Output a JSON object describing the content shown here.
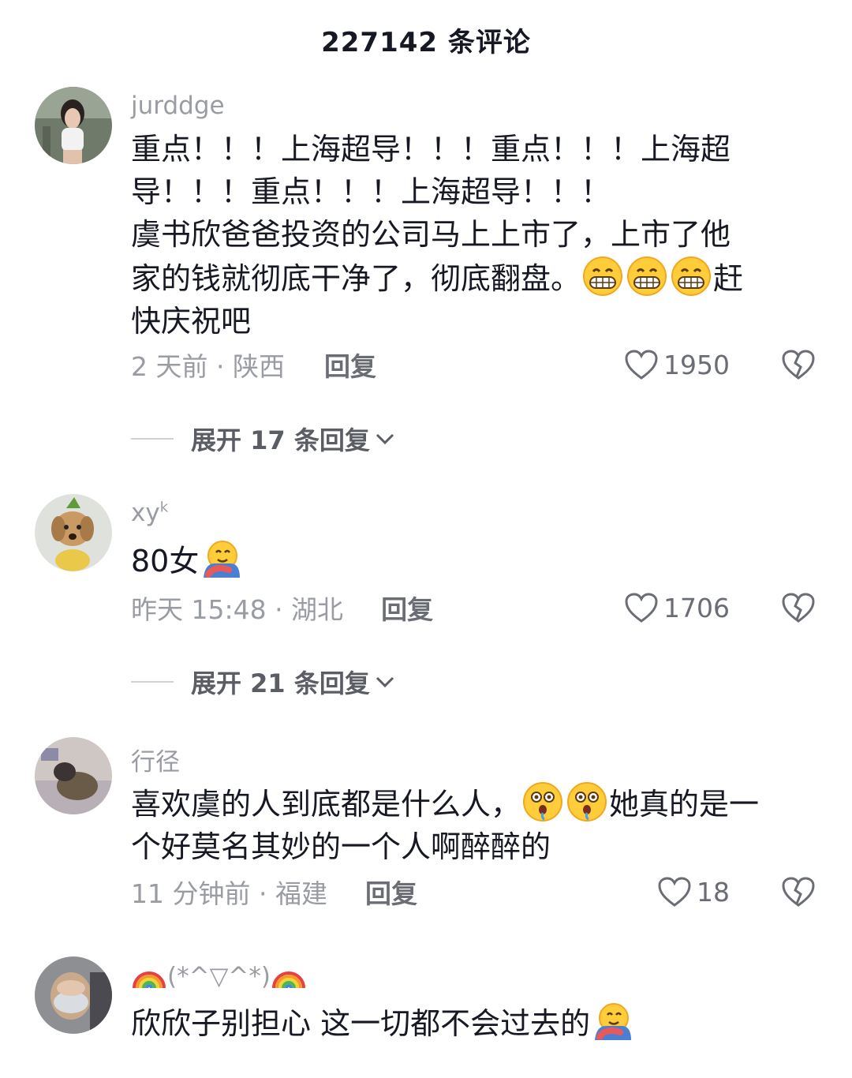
{
  "header": {
    "title": "227142 条评论"
  },
  "comments": [
    {
      "username": "jurddge",
      "lines": [
        "重点！！！上海超导！！！重点！！！上海超",
        "导！！！重点！！！上海超导！！！",
        "虞书欣爸爸投资的公司马上上市了，上市了他",
        "家的钱就彻底干净了，彻底翻盘。"
      ],
      "tail_after_emoji": "赶",
      "last_line": "快庆祝吧",
      "time_location": "2 天前 · 陕西",
      "reply_label": "回复",
      "likes": "1950",
      "expand_label": "展开 17 条回复"
    },
    {
      "username": "xy",
      "username_sup": "k",
      "text": "80女",
      "time_location": "昨天 15:48 · 湖北",
      "reply_label": "回复",
      "likes": "1706",
      "expand_label": "展开 21 条回复"
    },
    {
      "username": "行径",
      "line1_before": "喜欢虞的人到底都是什么人，",
      "line1_after": "她真的是一",
      "line2": "个好莫名其妙的一个人啊醉醉的",
      "time_location": "11 分钟前 · 福建",
      "reply_label": "回复",
      "likes": "18"
    },
    {
      "username": "(*^▽^*)",
      "text": "欣欣子别担心 这一切都不会过去的"
    }
  ],
  "icons": {
    "like": "heart-outline-icon",
    "dislike": "broken-heart-icon",
    "expand": "chevron-down-icon",
    "grin_emoji": "grinning-face-emoji",
    "hug_emoji": "hugging-face-emoji",
    "dizzy_emoji": "dizzy-face-emoji",
    "rainbow_emoji": "rainbow-emoji"
  }
}
